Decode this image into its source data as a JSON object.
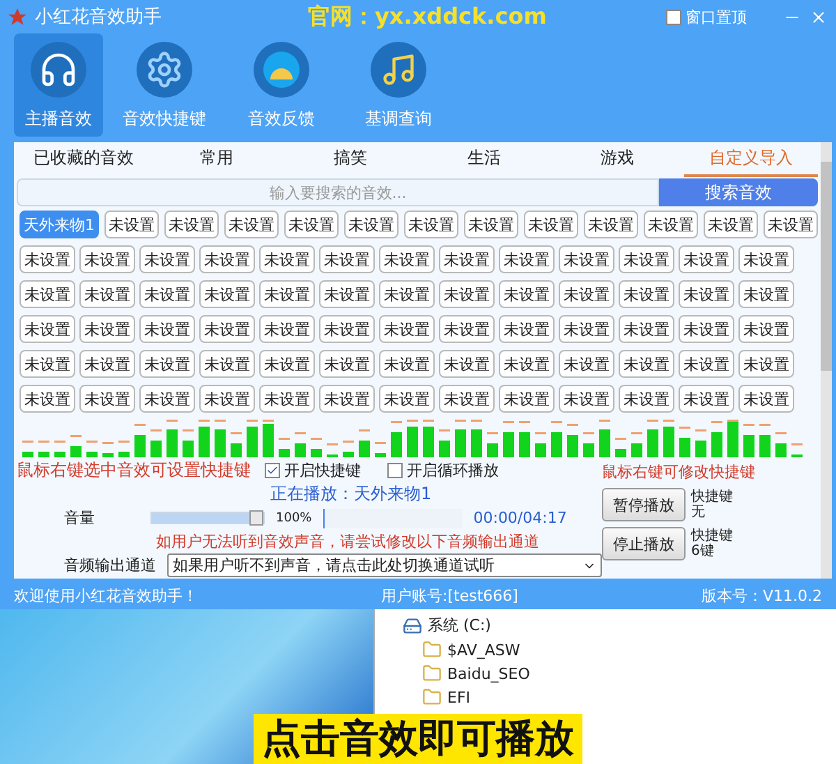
{
  "window": {
    "title": "小红花音效助手",
    "website": "官网：yx.xddck.com",
    "pin_on_top": {
      "label": "窗口置顶",
      "checked": false
    }
  },
  "nav": [
    {
      "label": "主播音效",
      "kind": "headphones",
      "selected": true
    },
    {
      "label": "音效快捷键",
      "kind": "gear",
      "selected": false
    },
    {
      "label": "音效反馈",
      "kind": "feedback",
      "selected": false
    },
    {
      "label": "基调查询",
      "kind": "music",
      "selected": false
    }
  ],
  "category_tabs": [
    {
      "label": "已收藏的音效",
      "selected": false
    },
    {
      "label": "常用",
      "selected": false
    },
    {
      "label": "搞笑",
      "selected": false
    },
    {
      "label": "生活",
      "selected": false
    },
    {
      "label": "游戏",
      "selected": false
    },
    {
      "label": "自定义导入",
      "selected": true
    }
  ],
  "search": {
    "placeholder": "输入要搜索的音效...",
    "button": "搜索音效"
  },
  "sound_buttons": [
    [
      {
        "label": "天外来物1",
        "selected": true
      },
      {
        "label": "未设置",
        "selected": false
      },
      {
        "label": "未设置",
        "selected": false
      },
      {
        "label": "未设置",
        "selected": false
      },
      {
        "label": "未设置",
        "selected": false
      },
      {
        "label": "未设置",
        "selected": false
      },
      {
        "label": "未设置",
        "selected": false
      },
      {
        "label": "未设置",
        "selected": false
      },
      {
        "label": "未设置",
        "selected": false
      },
      {
        "label": "未设置",
        "selected": false
      },
      {
        "label": "未设置",
        "selected": false
      },
      {
        "label": "未设置",
        "selected": false
      },
      {
        "label": "未设置",
        "selected": false
      }
    ],
    [
      {
        "label": "未设置",
        "selected": false
      },
      {
        "label": "未设置",
        "selected": false
      },
      {
        "label": "未设置",
        "selected": false
      },
      {
        "label": "未设置",
        "selected": false
      },
      {
        "label": "未设置",
        "selected": false
      },
      {
        "label": "未设置",
        "selected": false
      },
      {
        "label": "未设置",
        "selected": false
      },
      {
        "label": "未设置",
        "selected": false
      },
      {
        "label": "未设置",
        "selected": false
      },
      {
        "label": "未设置",
        "selected": false
      },
      {
        "label": "未设置",
        "selected": false
      },
      {
        "label": "未设置",
        "selected": false
      },
      {
        "label": "未设置",
        "selected": false
      }
    ],
    [
      {
        "label": "未设置",
        "selected": false
      },
      {
        "label": "未设置",
        "selected": false
      },
      {
        "label": "未设置",
        "selected": false
      },
      {
        "label": "未设置",
        "selected": false
      },
      {
        "label": "未设置",
        "selected": false
      },
      {
        "label": "未设置",
        "selected": false
      },
      {
        "label": "未设置",
        "selected": false
      },
      {
        "label": "未设置",
        "selected": false
      },
      {
        "label": "未设置",
        "selected": false
      },
      {
        "label": "未设置",
        "selected": false
      },
      {
        "label": "未设置",
        "selected": false
      },
      {
        "label": "未设置",
        "selected": false
      },
      {
        "label": "未设置",
        "selected": false
      }
    ],
    [
      {
        "label": "未设置",
        "selected": false
      },
      {
        "label": "未设置",
        "selected": false
      },
      {
        "label": "未设置",
        "selected": false
      },
      {
        "label": "未设置",
        "selected": false
      },
      {
        "label": "未设置",
        "selected": false
      },
      {
        "label": "未设置",
        "selected": false
      },
      {
        "label": "未设置",
        "selected": false
      },
      {
        "label": "未设置",
        "selected": false
      },
      {
        "label": "未设置",
        "selected": false
      },
      {
        "label": "未设置",
        "selected": false
      },
      {
        "label": "未设置",
        "selected": false
      },
      {
        "label": "未设置",
        "selected": false
      },
      {
        "label": "未设置",
        "selected": false
      }
    ],
    [
      {
        "label": "未设置",
        "selected": false
      },
      {
        "label": "未设置",
        "selected": false
      },
      {
        "label": "未设置",
        "selected": false
      },
      {
        "label": "未设置",
        "selected": false
      },
      {
        "label": "未设置",
        "selected": false
      },
      {
        "label": "未设置",
        "selected": false
      },
      {
        "label": "未设置",
        "selected": false
      },
      {
        "label": "未设置",
        "selected": false
      },
      {
        "label": "未设置",
        "selected": false
      },
      {
        "label": "未设置",
        "selected": false
      },
      {
        "label": "未设置",
        "selected": false
      },
      {
        "label": "未设置",
        "selected": false
      },
      {
        "label": "未设置",
        "selected": false
      }
    ],
    [
      {
        "label": "未设置",
        "selected": false
      },
      {
        "label": "未设置",
        "selected": false
      },
      {
        "label": "未设置",
        "selected": false
      },
      {
        "label": "未设置",
        "selected": false
      },
      {
        "label": "未设置",
        "selected": false
      },
      {
        "label": "未设置",
        "selected": false
      },
      {
        "label": "未设置",
        "selected": false
      },
      {
        "label": "未设置",
        "selected": false
      },
      {
        "label": "未设置",
        "selected": false
      },
      {
        "label": "未设置",
        "selected": false
      },
      {
        "label": "未设置",
        "selected": false
      },
      {
        "label": "未设置",
        "selected": false
      },
      {
        "label": "未设置",
        "selected": false
      }
    ]
  ],
  "controls": {
    "hotkey_hint": "鼠标右键选中音效可设置快捷键",
    "hotkey_enable": {
      "label": "开启快捷键",
      "checked": true
    },
    "loop": {
      "label": "开启循环播放",
      "checked": false
    },
    "now_playing": "正在播放：天外来物1",
    "volume": {
      "label": "音量",
      "level": 1,
      "reading": "100%"
    },
    "progress": {
      "level": 0,
      "time": "00:00/04:17"
    },
    "warning": "如用户无法听到音效声音，请尝试修改以下音频输出通道",
    "output": {
      "label": "音频输出通道",
      "value": "如果用户听不到声音，请点击此处切换通道试听"
    },
    "edit_hint": "鼠标右键可修改快捷键",
    "actions": [
      {
        "label": "暂停播放",
        "hotkey_label": "快捷键",
        "hotkey": "无"
      },
      {
        "label": "停止播放",
        "hotkey_label": "快捷键",
        "hotkey": "6键"
      }
    ]
  },
  "status_bar": {
    "welcome": "欢迎使用小红花音效助手！",
    "account": "用户账号:[test666]",
    "version": "版本号：V11.0.2"
  },
  "explorer": {
    "items": [
      {
        "label": "系统 (C:)",
        "kind": "drive"
      },
      {
        "label": "$AV_ASW",
        "kind": "folder"
      },
      {
        "label": "Baidu_SEO",
        "kind": "folder"
      },
      {
        "label": "EFI",
        "kind": "folder"
      }
    ]
  },
  "caption": "点击音效即可播放"
}
